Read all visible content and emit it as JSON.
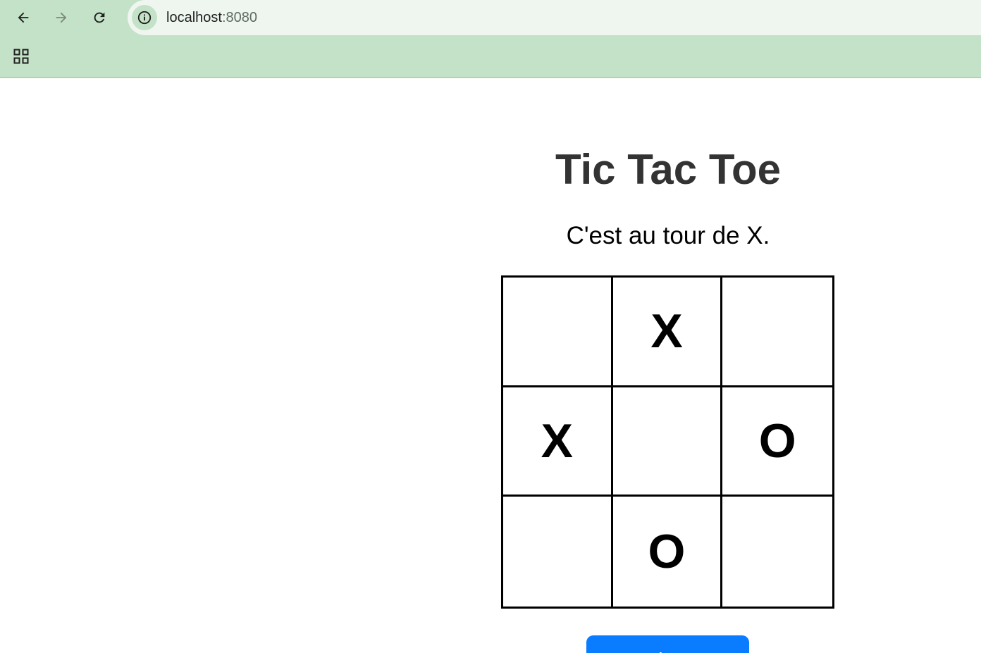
{
  "browser": {
    "url_host": "localhost",
    "url_port": ":8080",
    "icons": {
      "back": "arrow-left-icon",
      "forward": "arrow-right-icon",
      "reload": "reload-icon",
      "site_info": "info-icon",
      "apps": "apps-grid-icon"
    }
  },
  "game": {
    "title": "Tic Tac Toe",
    "status": "C'est au tour de X.",
    "board": [
      "",
      "X",
      "",
      "X",
      "",
      "O",
      "",
      "O",
      ""
    ],
    "restart_label": "Rejouer"
  },
  "colors": {
    "browser_bar": "#c4e2c7",
    "address_bar": "#eef6ef",
    "title": "#333333",
    "button": "#0a7cff"
  }
}
